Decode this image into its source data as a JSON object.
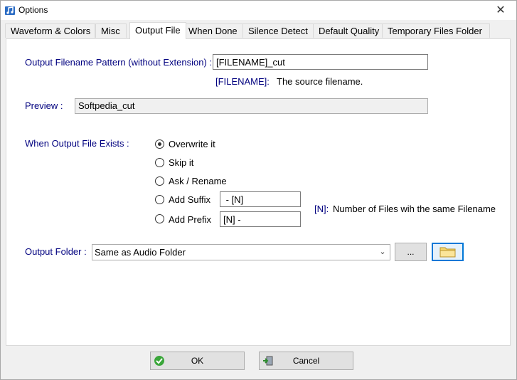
{
  "window": {
    "title": "Options",
    "close_glyph": "✕"
  },
  "tabs": [
    {
      "label": "Waveform & Colors"
    },
    {
      "label": "Misc"
    },
    {
      "label": "Output File"
    },
    {
      "label": "When Done"
    },
    {
      "label": "Silence Detect"
    },
    {
      "label": "Default Quality"
    },
    {
      "label": "Temporary Files Folder"
    }
  ],
  "active_tab": "Output File",
  "output_file": {
    "pattern_label": "Output Filename Pattern (without Extension) :",
    "pattern_value": "[FILENAME]_cut",
    "filename_token": "[FILENAME]:",
    "filename_desc": "The source filename.",
    "preview_label": "Preview :",
    "preview_value": "Softpedia_cut",
    "exists_label": "When Output File Exists  :",
    "options": [
      {
        "label": "Overwrite it",
        "selected": true
      },
      {
        "label": "Skip it",
        "selected": false
      },
      {
        "label": "Ask / Rename",
        "selected": false
      },
      {
        "label": "Add Suffix",
        "selected": false
      },
      {
        "label": "Add Prefix",
        "selected": false
      }
    ],
    "suffix_value": " - [N]",
    "prefix_value": "[N] -",
    "n_token": "[N]:",
    "n_desc": "Number of Files wih the same Filename",
    "folder_label": "Output Folder :",
    "folder_value": "Same as Audio Folder",
    "browse_label": "...",
    "combo_arrow": "⌄"
  },
  "footer": {
    "ok_label": "OK",
    "cancel_label": "Cancel"
  },
  "colors": {
    "label_blue": "#00007f",
    "focus_blue": "#0078d7",
    "panel_bg": "#ffffff",
    "window_bg": "#f0f0f0"
  }
}
